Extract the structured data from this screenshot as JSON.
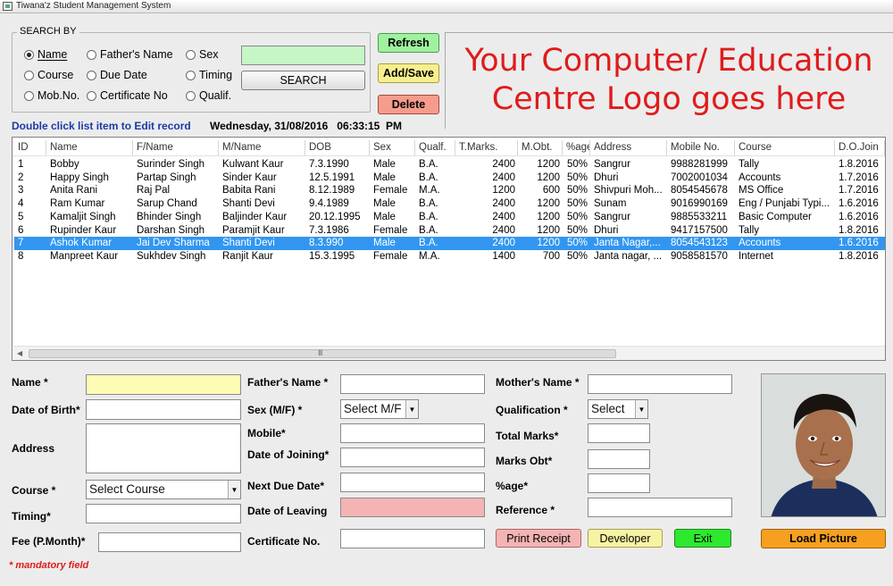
{
  "window": {
    "title": "Tiwana'z Student Management System"
  },
  "search": {
    "group_label": "SEARCH BY",
    "options": [
      {
        "label": "Name",
        "selected": true
      },
      {
        "label": "Father's Name",
        "selected": false
      },
      {
        "label": "Sex",
        "selected": false
      },
      {
        "label": "Course",
        "selected": false
      },
      {
        "label": "Due Date",
        "selected": false
      },
      {
        "label": "Timing",
        "selected": false
      },
      {
        "label": "Mob.No.",
        "selected": false
      },
      {
        "label": "Certificate No",
        "selected": false
      },
      {
        "label": "Qualif.",
        "selected": false
      }
    ],
    "input_value": "",
    "button_label": "SEARCH"
  },
  "actions": {
    "refresh": "Refresh",
    "add_save": "Add/Save",
    "delete": "Delete"
  },
  "logo": {
    "line1": "Your Computer/ Education",
    "line2": "Centre Logo goes here"
  },
  "hint": "Double click list item to Edit record",
  "datetime": "Wednesday, 31/08/2016   06:33:15  PM",
  "table": {
    "columns": [
      "ID",
      "Name",
      "F/Name",
      "M/Name",
      "DOB",
      "Sex",
      "Qualf.",
      "T.Marks.",
      "M.Obt.",
      "%age",
      "Address",
      "Mobile No.",
      "Course",
      "D.O.Join"
    ],
    "rows": [
      [
        "1",
        "Bobby",
        "Surinder Singh",
        "Kulwant Kaur",
        "7.3.1990",
        "Male",
        "B.A.",
        "2400",
        "1200",
        "50%",
        "Sangrur",
        "9988281999",
        "Tally",
        "1.8.2016"
      ],
      [
        "2",
        "Happy Singh",
        "Partap Singh",
        "Sinder Kaur",
        "12.5.1991",
        "Male",
        "B.A.",
        "2400",
        "1200",
        "50%",
        "Dhuri",
        "7002001034",
        "Accounts",
        "1.7.2016"
      ],
      [
        "3",
        "Anita Rani",
        "Raj Pal",
        "Babita Rani",
        "8.12.1989",
        "Female",
        "M.A.",
        "1200",
        "600",
        "50%",
        "Shivpuri Moh...",
        "8054545678",
        "MS Office",
        "1.7.2016"
      ],
      [
        "4",
        "Ram Kumar",
        "Sarup Chand",
        "Shanti Devi",
        "9.4.1989",
        "Male",
        "B.A.",
        "2400",
        "1200",
        "50%",
        "Sunam",
        "9016990169",
        "Eng / Punjabi Typi...",
        "1.6.2016"
      ],
      [
        "5",
        "Kamaljit Singh",
        "Bhinder Singh",
        "Baljinder Kaur",
        "20.12.1995",
        "Male",
        "B.A.",
        "2400",
        "1200",
        "50%",
        "Sangrur",
        "9885533211",
        "Basic Computer",
        "1.6.2016"
      ],
      [
        "6",
        "Rupinder Kaur",
        "Darshan Singh",
        "Paramjit Kaur",
        "7.3.1986",
        "Female",
        "B.A.",
        "2400",
        "1200",
        "50%",
        "Dhuri",
        "9417157500",
        "Tally",
        "1.8.2016"
      ],
      [
        "7",
        "Ashok Kumar",
        "Jai Dev Sharma",
        "Shanti Devi",
        "8.3.990",
        "Male",
        "B.A.",
        "2400",
        "1200",
        "50%",
        "Janta Nagar,...",
        "8054543123",
        "Accounts",
        "1.6.2016"
      ],
      [
        "8",
        "Manpreet Kaur",
        "Sukhdev Singh",
        "Ranjit Kaur",
        "15.3.1995",
        "Female",
        "M.A.",
        "1400",
        "700",
        "50%",
        "Janta nagar, ...",
        "9058581570",
        "Internet",
        "1.8.2016"
      ]
    ],
    "selected_row": 7,
    "scroll_marker": "III"
  },
  "form": {
    "name_label": "Name *",
    "dob_label": "Date of Birth*",
    "address_label": "Address",
    "course_label": "Course *",
    "course_value": "Select Course",
    "timing_label": "Timing*",
    "fee_label": "Fee (P.Month)*",
    "father_label": "Father's Name *",
    "sex_label": "Sex (M/F) *",
    "sex_value": "Select M/F",
    "mobile_label": "Mobile*",
    "doj_label": "Date of Joining*",
    "due_label": "Next Due Date*",
    "dol_label": "Date of Leaving",
    "cert_label": "Certificate No.",
    "mother_label": "Mother's Name *",
    "qual_label": "Qualification *",
    "qual_value": "Select",
    "total_label": "Total Marks*",
    "obt_label": "Marks Obt*",
    "pct_label": "%age*",
    "ref_label": "Reference *"
  },
  "buttons": {
    "print": "Print Receipt",
    "developer": "Developer",
    "exit": "Exit",
    "load_picture": "Load Picture"
  },
  "note": "* mandatory field",
  "colors": {
    "name_field": "#fdfcb4",
    "search_field": "#c6f5c6",
    "leaving_field": "#f5b4b4",
    "selected_row": "#3296f0",
    "logo_text": "#e01b1b"
  }
}
